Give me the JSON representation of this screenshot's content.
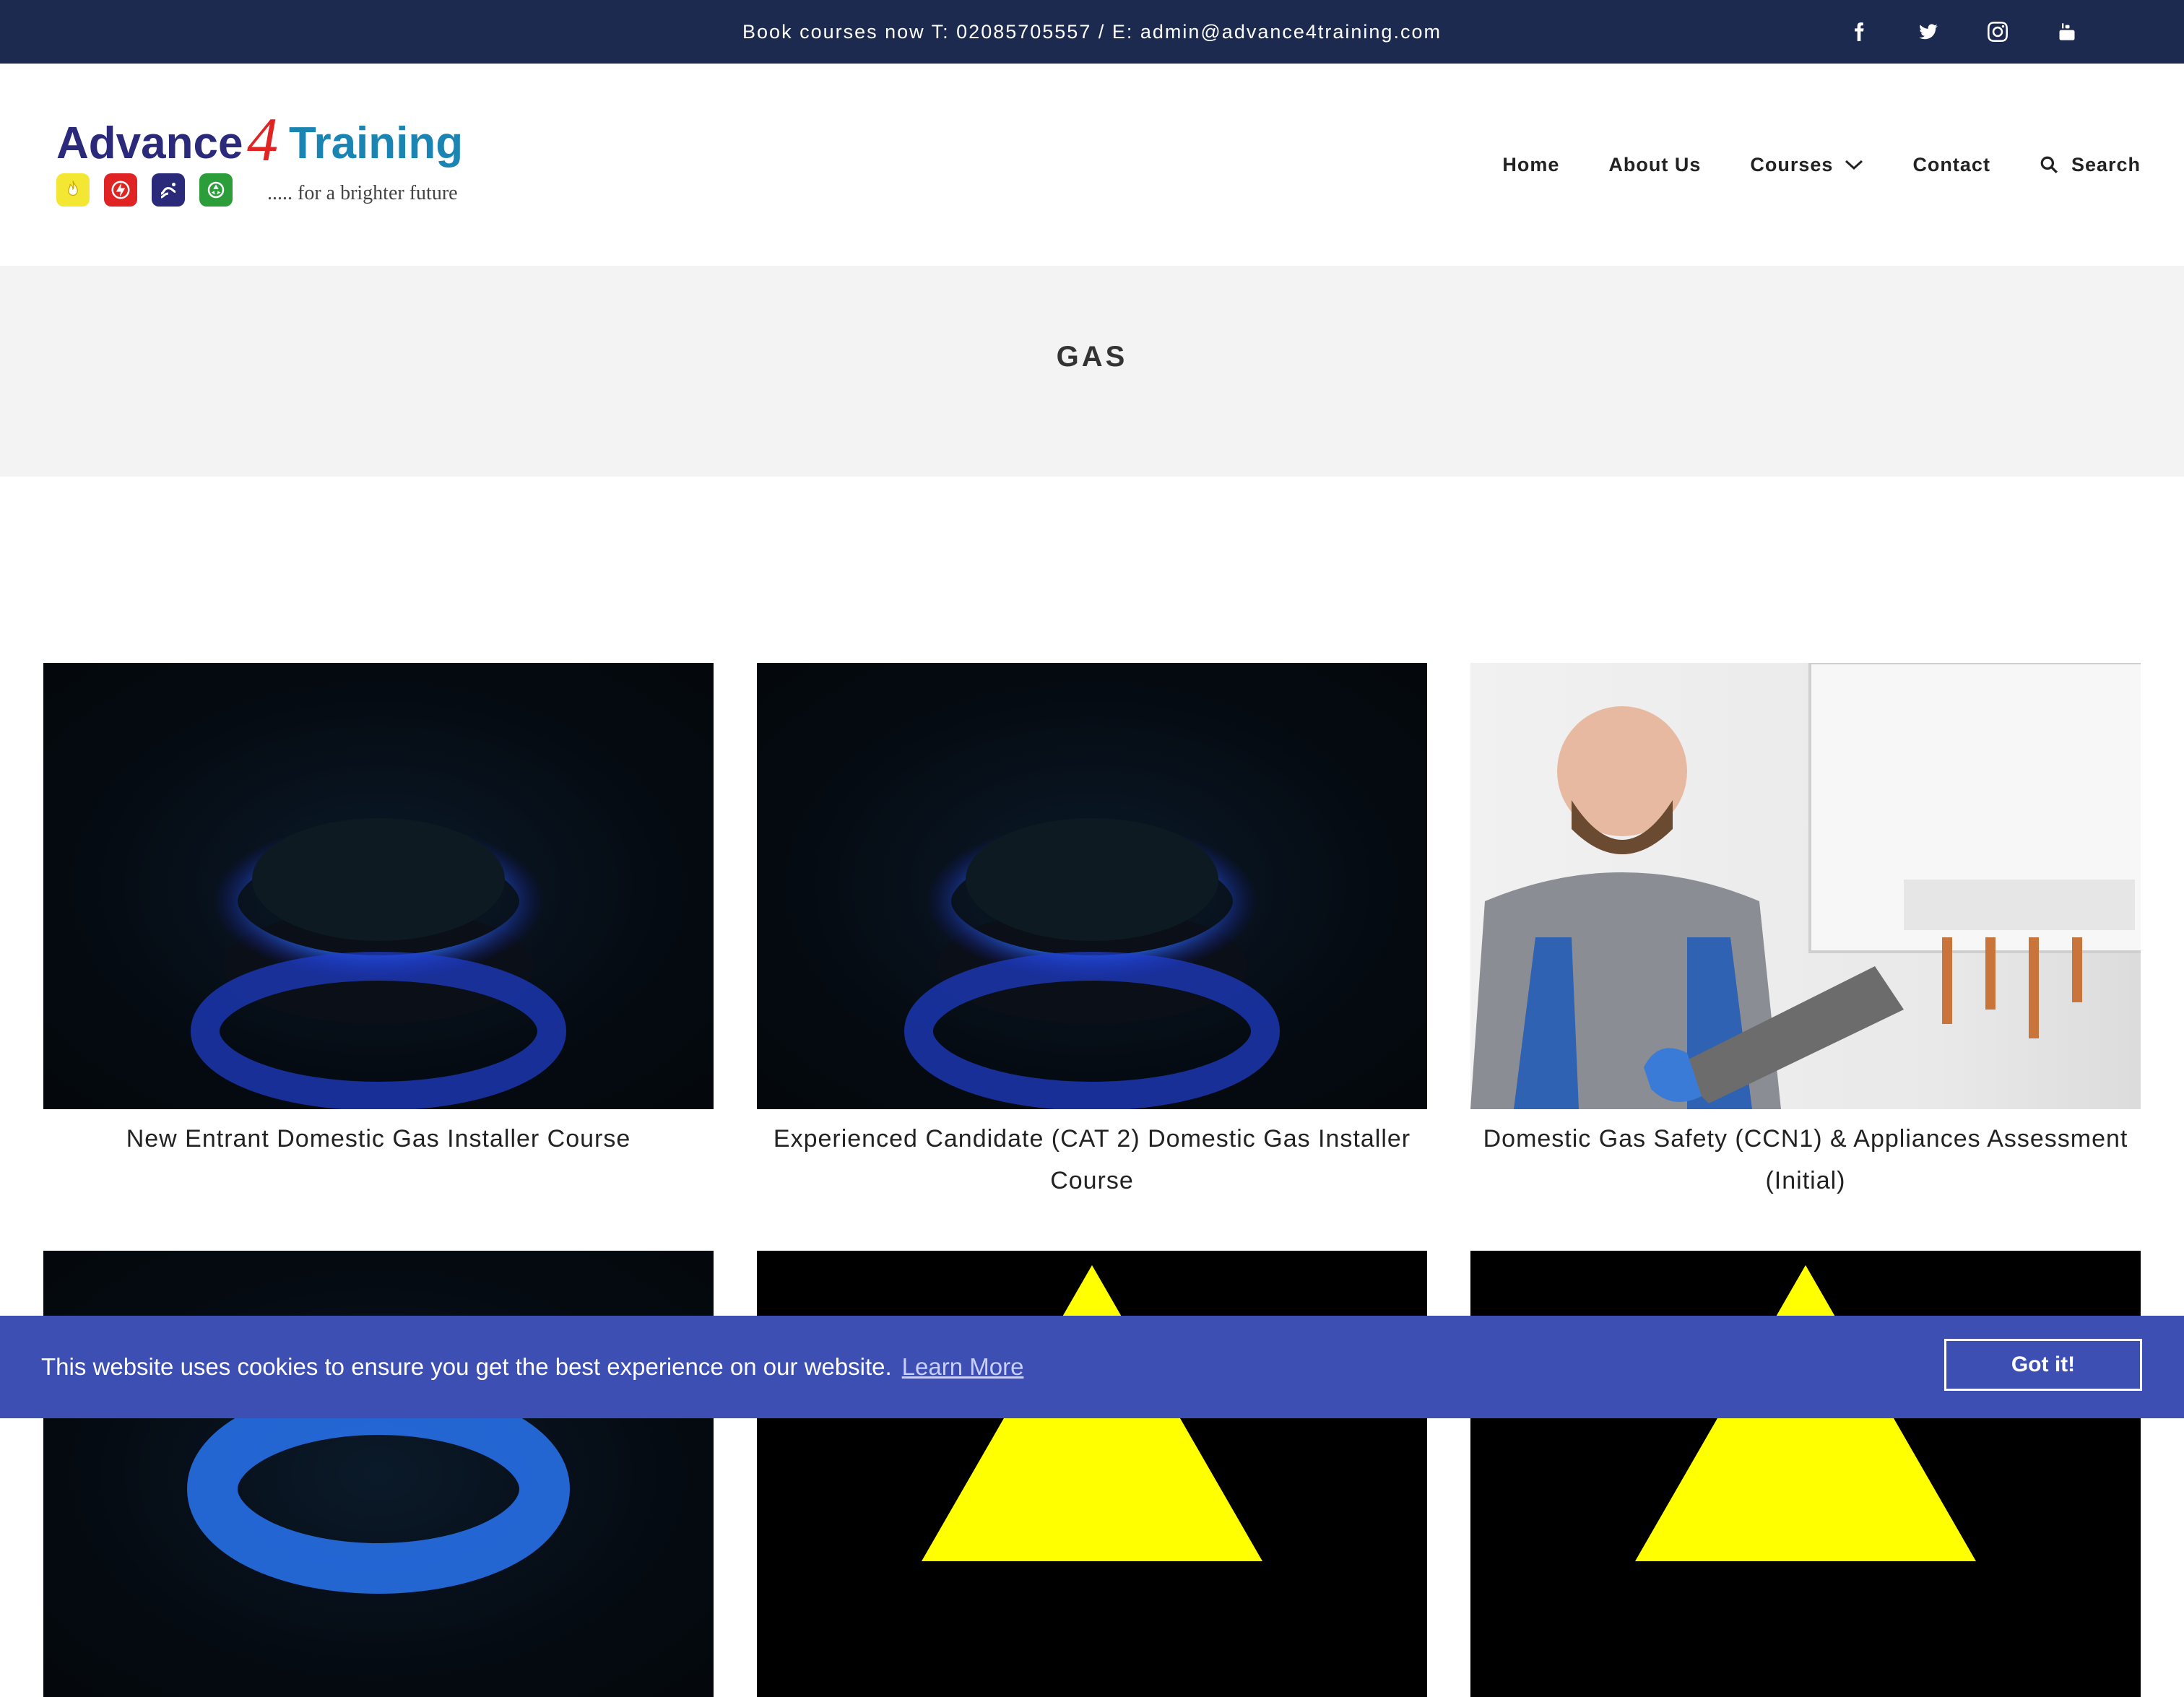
{
  "topbar": {
    "contact_text": "Book courses now T: 02085705557 / E: admin@advance4training.com",
    "social": [
      "facebook-icon",
      "twitter-icon",
      "instagram-icon",
      "youtube-icon"
    ]
  },
  "logo": {
    "word1": "Advance",
    "word2": "4",
    "word3": "Training",
    "tagline": "..... for a brighter future",
    "colors": {
      "advance": "#2b2a7a",
      "four": "#e02424",
      "training": "#1a84b3"
    }
  },
  "nav": {
    "home": "Home",
    "about": "About Us",
    "courses": "Courses",
    "contact": "Contact",
    "search": "Search"
  },
  "page": {
    "title": "GAS"
  },
  "courses": [
    {
      "title": "New Entrant Domestic Gas Installer Course",
      "image": "gas-flame"
    },
    {
      "title": "Experienced Candidate (CAT 2) Domestic Gas Installer Course",
      "image": "gas-flame"
    },
    {
      "title": "Domestic Gas Safety (CCN1) & Appliances Assessment (Initial)",
      "image": "technician-boiler"
    },
    {
      "title": "",
      "image": "gas-flame"
    },
    {
      "title": "",
      "image": "warning-sign"
    },
    {
      "title": "",
      "image": "warning-sign"
    }
  ],
  "cookie": {
    "message": "This website uses cookies to ensure you get the best experience on our website.",
    "learn_more": "Learn More",
    "accept": "Got it!"
  },
  "colors": {
    "topbar": "#1b2a4e",
    "banner": "#f3f3f3",
    "cookie": "#3d4fb3"
  }
}
